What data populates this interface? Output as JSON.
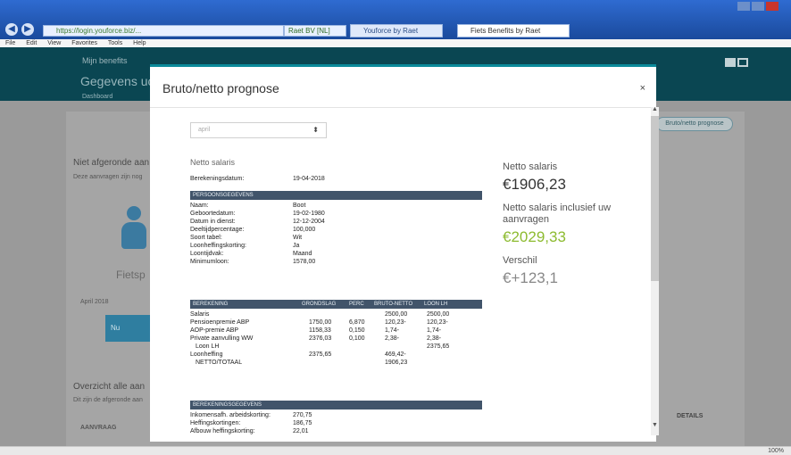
{
  "browser": {
    "address": "https://login.youforce.biz/...",
    "address_extra": "Raet BV [NL]",
    "tabs": [
      {
        "label": "Youforce by Raet"
      },
      {
        "label": "Fiets Benefits by Raet"
      }
    ],
    "menu": [
      "File",
      "Edit",
      "View",
      "Favorites",
      "Tools",
      "Help"
    ],
    "zoom": "100%"
  },
  "background_page": {
    "brand": "Mijn benefits",
    "title": "Gegevens uc",
    "subtitle": "Dashboard",
    "right_button": "Bruto/netto prognose",
    "heading1": "Niet afgeronde aan",
    "text1": "Deze aanvragen zijn nog",
    "figure_label": "Fietsp",
    "date_label": "April 2018",
    "blue_button": "Nu",
    "heading2": "Overzicht alle aan",
    "text2": "Dit zijn de afgeronde aan",
    "col_aanvraag": "AANVRAAG",
    "col_details": "DETAILS"
  },
  "modal": {
    "title": "Bruto/netto prognose",
    "close_icon": "×",
    "period_select": "april",
    "section_title": "Netto salaris",
    "calc_date_label": "Berekeningsdatum:",
    "calc_date_value": "19-04-2018",
    "personal_header": "PERSOONSGEGEVENS",
    "personal": [
      {
        "label": "Naam:",
        "value": "Boot"
      },
      {
        "label": "Geboortedatum:",
        "value": "19-02-1980"
      },
      {
        "label": "Datum in dienst:",
        "value": "12-12-2004"
      },
      {
        "label": "Deeltijdpercentage:",
        "value": "100,000"
      },
      {
        "label": "Soort tabel:",
        "value": "Wit"
      },
      {
        "label": "Loonheffingskorting:",
        "value": "Ja"
      },
      {
        "label": "Loontijdvak:",
        "value": "Maand"
      },
      {
        "label": "Minimumloon:",
        "value": "1578,00"
      }
    ],
    "calc_header": {
      "c1": "BEREKENING",
      "c2": "GRONDSLAG",
      "c3": "PERC",
      "c4": "BRUTO-NETTO",
      "c5": "LOON LH"
    },
    "calc_rows": [
      {
        "name": "Salaris",
        "grondslag": "",
        "perc": "",
        "bruto": "2500,00",
        "loon": "2500,00"
      },
      {
        "name": "Pensioenpremie ABP",
        "grondslag": "1750,00",
        "perc": "6,870",
        "bruto": "120,23-",
        "loon": "120,23-"
      },
      {
        "name": "AOP-premie ABP",
        "grondslag": "1158,33",
        "perc": "0,150",
        "bruto": "1,74-",
        "loon": "1,74-"
      },
      {
        "name": "Private aanvulling WW",
        "grondslag": "2376,03",
        "perc": "0,100",
        "bruto": "2,38-",
        "loon": "2,38-"
      },
      {
        "name": "Loon LH",
        "grondslag": "",
        "perc": "",
        "bruto": "",
        "loon": "2375,65"
      },
      {
        "name": "Loonheffing",
        "grondslag": "2375,65",
        "perc": "",
        "bruto": "469,42-",
        "loon": ""
      },
      {
        "name": "NETTO/TOTAAL",
        "grondslag": "",
        "perc": "",
        "bruto": "1906,23",
        "loon": ""
      }
    ],
    "calc_info_header": "BEREKENINGSGEGEVENS",
    "calc_info": [
      {
        "label": "Inkomensafh. arbeidskorting:",
        "value": "270,75"
      },
      {
        "label": "Heffingskortingen:",
        "value": "186,75"
      },
      {
        "label": "Afbouw heffingskorting:",
        "value": "22,01"
      }
    ],
    "summary": {
      "netto_label": "Netto salaris",
      "netto_value": "€1906,23",
      "incl_label": "Netto salaris inclusief uw aanvragen",
      "incl_value": "€2029,33",
      "diff_label": "Verschil",
      "diff_value": "€+123,1"
    }
  },
  "colors": {
    "accent": "#0b8a9a",
    "header_bar": "#41546a",
    "green_value": "#8dbb30"
  }
}
